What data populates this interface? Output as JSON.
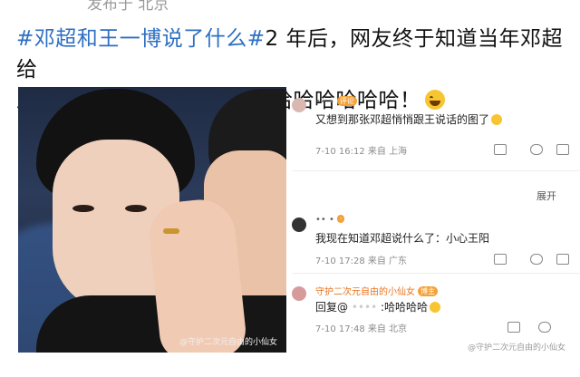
{
  "header": {
    "location": "发布于 北京",
    "headline_tag": "#邓超和王一博说了什么#",
    "headline_rest_line1": "2 年后，网友终于知道当年邓超给",
    "headline_line2": "王一博说悄悄话的答案了！哈哈哈哈哈哈！"
  },
  "photo": {
    "watermark": "@守护二次元自由的小仙女"
  },
  "comments": [
    {
      "name": "•• •",
      "badge": "评论",
      "text": "又想到那张邓超悄悄跟王说话的图了",
      "meta": "7-10 16:12 来自 上海"
    },
    {
      "name": "•• •",
      "badge": "·",
      "text": "我现在知道邓超说什么了：小心王阳",
      "meta": "7-10 17:28 来自 广东"
    },
    {
      "name": "守护二次元自由的小仙女",
      "badge": "博主",
      "text": "回复@",
      "text_suffix": ":哈哈哈哈",
      "meta": "7-10 17:48 来自 北京"
    }
  ],
  "collapse_label": "展开",
  "bottom_watermark": "@守护二次元自由的小仙女",
  "colors": {
    "tag": "#2d6fc3",
    "name_orange": "#e8731d",
    "meta": "#8b8b8b"
  }
}
